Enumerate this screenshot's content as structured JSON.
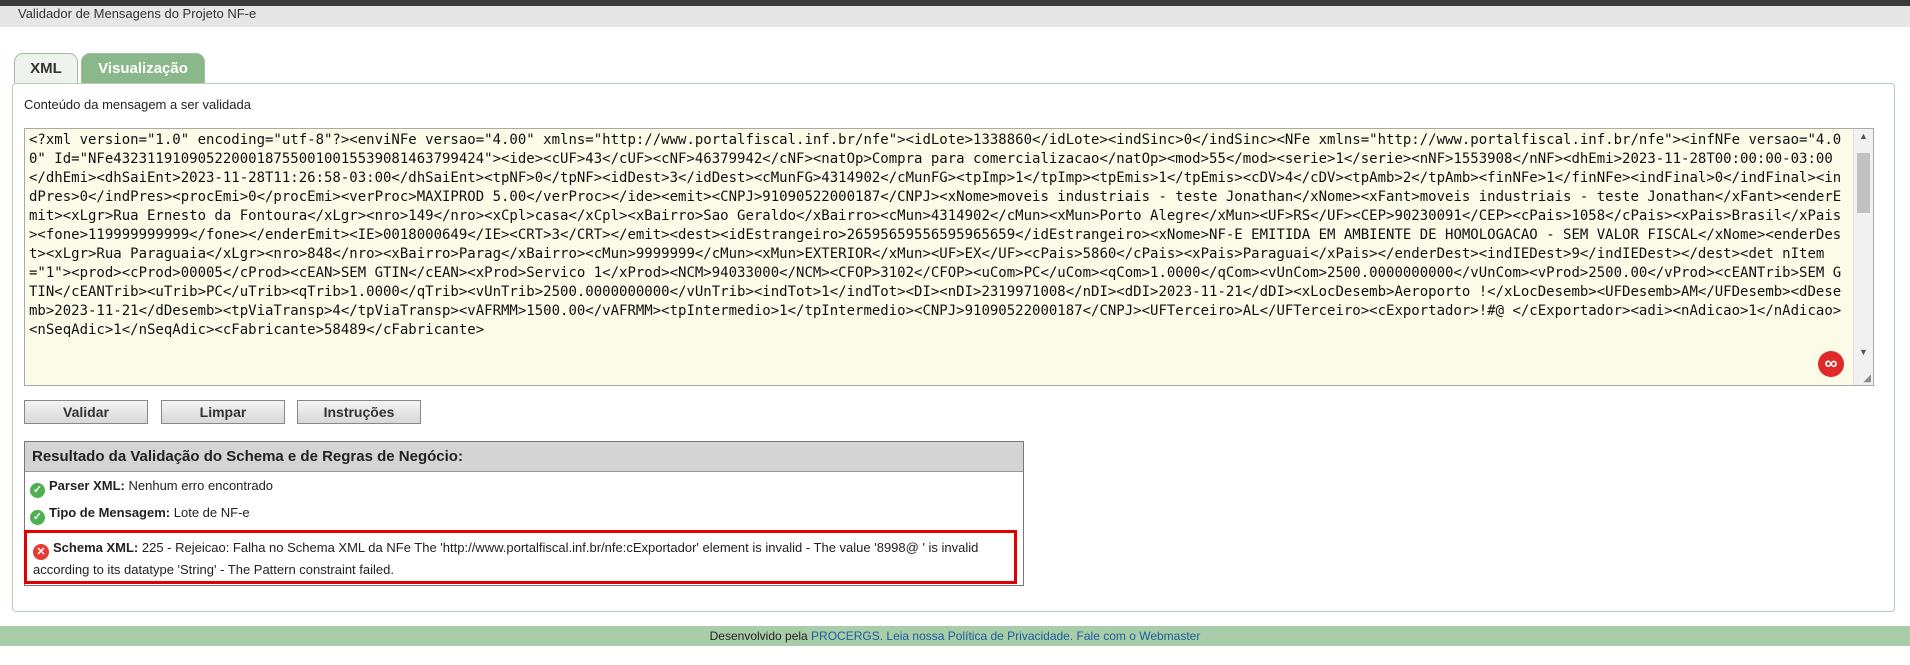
{
  "window": {
    "title": "Validador de Mensagens do Projeto NF-e"
  },
  "tabs": [
    {
      "label": "XML",
      "active": false
    },
    {
      "label": "Visualização",
      "active": true
    }
  ],
  "content": {
    "label": "Conteúdo da mensagem a ser validada",
    "xml": "<?xml version=\"1.0\" encoding=\"utf-8\"?><enviNFe versao=\"4.00\" xmlns=\"http://www.portalfiscal.inf.br/nfe\"><idLote>1338860</idLote><indSinc>0</indSinc><NFe xmlns=\"http://www.portalfiscal.inf.br/nfe\"><infNFe versao=\"4.00\" Id=\"NFe43231191090522000187550010015539081463799424\"><ide><cUF>43</cUF><cNF>46379942</cNF><natOp>Compra para comercializacao</natOp><mod>55</mod><serie>1</serie><nNF>1553908</nNF><dhEmi>2023-11-28T00:00:00-03:00</dhEmi><dhSaiEnt>2023-11-28T11:26:58-03:00</dhSaiEnt><tpNF>0</tpNF><idDest>3</idDest><cMunFG>4314902</cMunFG><tpImp>1</tpImp><tpEmis>1</tpEmis><cDV>4</cDV><tpAmb>2</tpAmb><finNFe>1</finNFe><indFinal>0</indFinal><indPres>0</indPres><procEmi>0</procEmi><verProc>MAXIPROD 5.00</verProc></ide><emit><CNPJ>91090522000187</CNPJ><xNome>moveis industriais - teste Jonathan</xNome><xFant>moveis industriais - teste Jonathan</xFant><enderEmit><xLgr>Rua Ernesto da Fontoura</xLgr><nro>149</nro><xCpl>casa</xCpl><xBairro>Sao Geraldo</xBairro><cMun>4314902</cMun><xMun>Porto Alegre</xMun><UF>RS</UF><CEP>90230091</CEP><cPais>1058</cPais><xPais>Brasil</xPais><fone>119999999999</fone></enderEmit><IE>0018000649</IE><CRT>3</CRT></emit><dest><idEstrangeiro>26595659556595965659</idEstrangeiro><xNome>NF-E EMITIDA EM AMBIENTE DE HOMOLOGACAO - SEM VALOR FISCAL</xNome><enderDest><xLgr>Rua Paraguaia</xLgr><nro>848</nro><xBairro>Parag</xBairro><cMun>9999999</cMun><xMun>EXTERIOR</xMun><UF>EX</UF><cPais>5860</cPais><xPais>Paraguai</xPais></enderDest><indIEDest>9</indIEDest></dest><det nItem=\"1\"><prod><cProd>00005</cProd><cEAN>SEM GTIN</cEAN><xProd>Servico 1</xProd><NCM>94033000</NCM><CFOP>3102</CFOP><uCom>PC</uCom><qCom>1.0000</qCom><vUnCom>2500.0000000000</vUnCom><vProd>2500.00</vProd><cEANTrib>SEM GTIN</cEANTrib><uTrib>PC</uTrib><qTrib>1.0000</qTrib><vUnTrib>2500.0000000000</vUnTrib><indTot>1</indTot><DI><nDI>2319971008</nDI><dDI>2023-11-21</dDI><xLocDesemb>Aeroporto !</xLocDesemb><UFDesemb>AM</UFDesemb><dDesemb>2023-11-21</dDesemb><tpViaTransp>4</tpViaTransp><vAFRMM>1500.00</vAFRMM><tpIntermedio>1</tpIntermedio><CNPJ>91090522000187</CNPJ><UFTerceiro>AL</UFTerceiro><cExportador>!#@ </cExportador><adi><nAdicao>1</nAdicao><nSeqAdic>1</nSeqAdic><cFabricante>58489</cFabricante>"
  },
  "buttons": {
    "validar": "Validar",
    "limpar": "Limpar",
    "instrucoes": "Instruções"
  },
  "result": {
    "title": "Resultado da Validação do Schema e de Regras de Negócio:",
    "rows": [
      {
        "label": "Parser XML:",
        "value": "Nenhum erro encontrado",
        "status": "ok"
      },
      {
        "label": "Tipo de Mensagem:",
        "value": "Lote de NF-e",
        "status": "ok"
      },
      {
        "label": "Schema XML:",
        "value": "225 - Rejeicao: Falha no Schema XML da NFe The 'http://www.portalfiscal.inf.br/nfe:cExportador' element is invalid - The value '8998@ ' is invalid according to its datatype 'String' - The Pattern constraint failed.",
        "status": "error"
      }
    ]
  },
  "footer": {
    "prefix": "Desenvolvido pela",
    "procergs": "PROCERGS.",
    "privacy": "Leia nossa Política de Privacidade.",
    "webmaster": "Fale com o Webmaster"
  },
  "colors": {
    "tab_active": "#8ab88a",
    "footer_bg": "#a9cca9",
    "error": "#e00000",
    "ok": "#4caf50",
    "link": "#1b5d9c"
  }
}
